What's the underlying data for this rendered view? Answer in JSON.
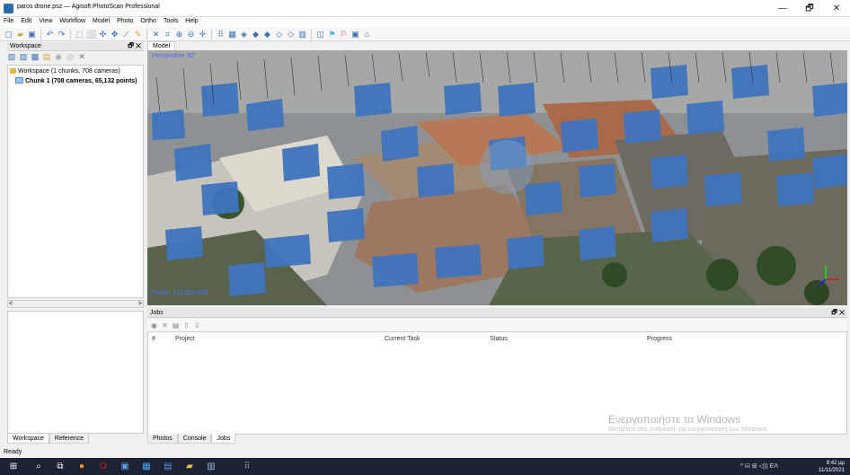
{
  "window": {
    "title": "paros drone.psz — Agisoft PhotoScan Professional",
    "min": "—",
    "max": "🗗",
    "close": "✕"
  },
  "menu": [
    "File",
    "Edit",
    "View",
    "Workflow",
    "Model",
    "Photo",
    "Ortho",
    "Tools",
    "Help"
  ],
  "workspace": {
    "header": "Workspace",
    "header_ctl": "🗗 ✕",
    "root": "Workspace (1 chunks, 708 cameras)",
    "chunk": "Chunk 1 (708 cameras, 65,132 points)",
    "scroll_left": "<",
    "scroll_right": ">"
  },
  "left_tabs": [
    "Workspace",
    "Reference"
  ],
  "model": {
    "tab": "Model",
    "perspective": "Perspective 30°",
    "points": "Points: 120,298,826"
  },
  "jobs": {
    "header": "Jobs",
    "header_ctl": "🗗 ✕",
    "columns": [
      "#",
      "Project",
      "Current Task",
      "Status",
      "Progress"
    ]
  },
  "bottom_tabs": [
    "Photos",
    "Console",
    "Jobs"
  ],
  "watermark": {
    "line1": "Ενεργοποιήστε τα Windows",
    "line2": "Μεταβείτε στις ρυθμίσεις για ενεργοποίηση των Windows."
  },
  "status": "Ready",
  "taskbar": {
    "tray": "^ ⛁ ⊞ ◁)) ΕΛ",
    "time": "8:42 μμ",
    "date": "11/11/2021"
  }
}
